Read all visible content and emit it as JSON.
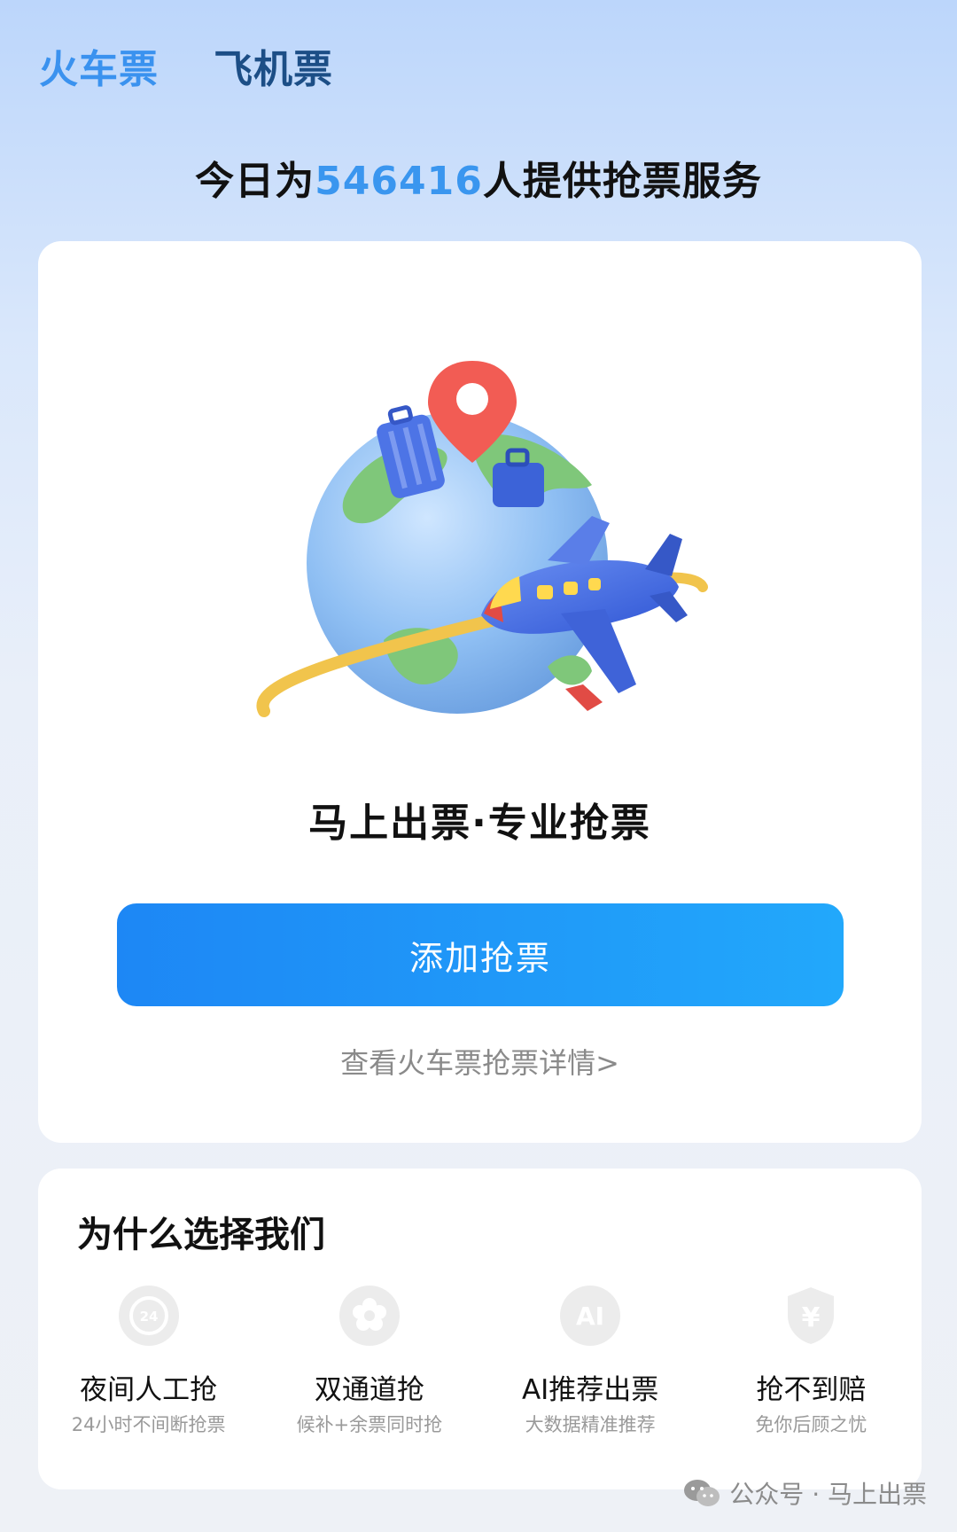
{
  "tabs": [
    {
      "label": "火车票",
      "active": true
    },
    {
      "label": "飞机票",
      "active": false
    }
  ],
  "headline": {
    "prefix": "今日为",
    "count": "546416",
    "suffix": "人提供抢票服务"
  },
  "main_card": {
    "slogan": "马上出票·专业抢票",
    "cta_label": "添加抢票",
    "detail_link": "查看火车票抢票详情>"
  },
  "why": {
    "title": "为什么选择我们",
    "features": [
      {
        "name": "夜间人工抢",
        "desc": "24小时不间断抢票",
        "icon": "24h-clock-icon"
      },
      {
        "name": "双通道抢",
        "desc": "候补+余票同时抢",
        "icon": "flower-icon"
      },
      {
        "name": "AI推荐出票",
        "desc": "大数据精准推荐",
        "icon": "ai-icon"
      },
      {
        "name": "抢不到赔",
        "desc": "免你后顾之忧",
        "icon": "yen-shield-icon"
      }
    ]
  },
  "watermark": "公众号 · 马上出票",
  "colors": {
    "accent": "#3a92ef",
    "button_start": "#1d87f5",
    "button_end": "#22a8fb"
  }
}
